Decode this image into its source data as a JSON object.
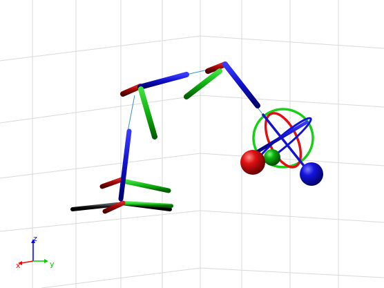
{
  "scene": {
    "background": "#ffffff",
    "grid_color": "#d6d6d6",
    "colors": {
      "red": "#cc0000",
      "dark_red": "#7a0000",
      "green": "#00c000",
      "blue": "#0000cc",
      "dark_blue": "#00008a",
      "black": "#111111",
      "link": "#3a8fd9"
    }
  },
  "axes_triad": {
    "x_label": "x",
    "y_label": "y",
    "z_label": "z",
    "x_color": "#ff0000",
    "y_color": "#00cc00",
    "z_color": "#0000ff"
  }
}
